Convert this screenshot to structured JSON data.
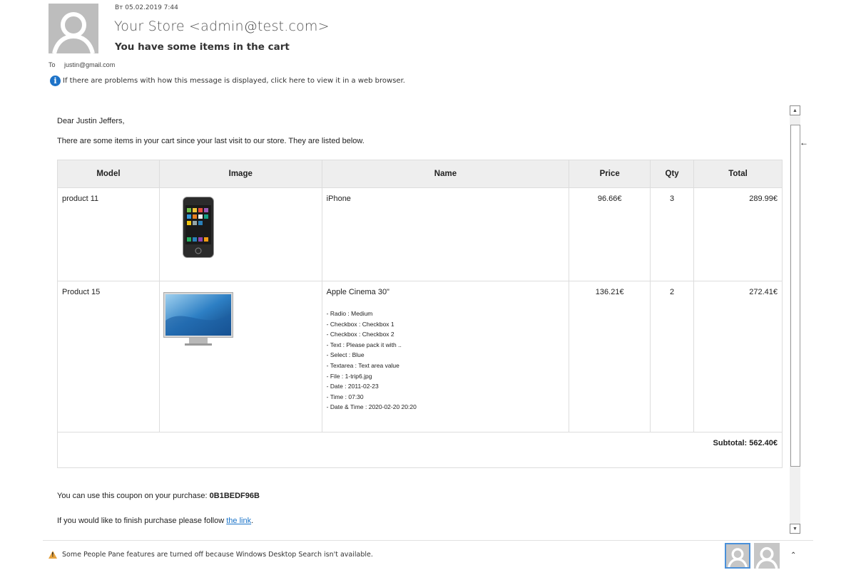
{
  "header": {
    "date": "Вт 05.02.2019 7:44",
    "sender": "Your Store <admin@test.com>",
    "subject": "You have some items in the cart",
    "to_label": "To",
    "to_address": "justin@gmail.com",
    "info_text": "If there are problems with how this message is displayed, click here to view it in a web browser."
  },
  "body": {
    "greeting": "Dear Justin Jeffers,",
    "intro": "There are some items in your cart since your last visit to our store. They are listed below.",
    "table": {
      "headers": [
        "Model",
        "Image",
        "Name",
        "Price",
        "Qty",
        "Total"
      ],
      "rows": [
        {
          "model": "product 11",
          "image": "iPhone product image",
          "name": "iPhone",
          "options": [],
          "price": "96.66€",
          "qty": "3",
          "total": "289.99€"
        },
        {
          "model": "Product 15",
          "image": "Apple Cinema monitor image",
          "name": "Apple Cinema 30\"",
          "options": [
            "- Radio : Medium",
            "- Checkbox : Checkbox 1",
            "- Checkbox : Checkbox 2",
            "- Text : Please pack it with ..",
            "- Select : Blue",
            "- Textarea : Text area value",
            "- File : 1-trip6.jpg",
            "- Date : 2011-02-23",
            "- Time : 07:30",
            "- Date & Time : 2020-02-20 20:20"
          ],
          "price": "136.21€",
          "qty": "2",
          "total": "272.41€"
        }
      ],
      "subtotal": "Subtotal: 562.40€"
    },
    "coupon_prefix": "You can use this coupon on your purchase: ",
    "coupon_code": "0B1BEDF96B",
    "follow_prefix": "If you would like to finish purchase please follow ",
    "follow_link": "the link",
    "follow_suffix": "."
  },
  "footer": {
    "warning": "Some People Pane features are turned off because Windows Desktop Search isn't available."
  },
  "colors": {
    "link": "#1a73c8",
    "info_icon": "#1e73c8",
    "warning_icon": "#e6a23c",
    "table_header_bg": "#eeeeee"
  },
  "icons": [
    "avatar-placeholder-icon",
    "info-icon",
    "warning-icon",
    "chevron-up-icon",
    "scroll-up-icon",
    "scroll-down-icon"
  ]
}
